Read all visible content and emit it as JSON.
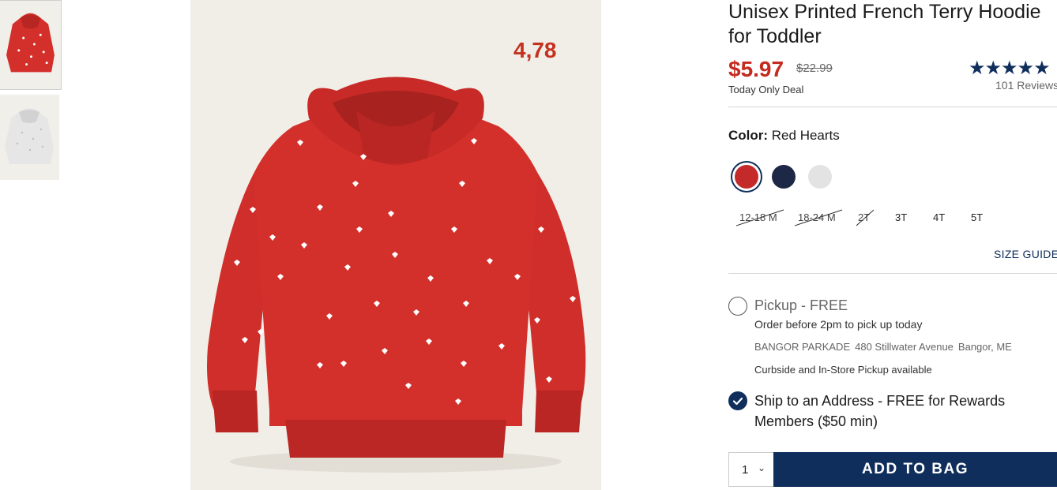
{
  "product": {
    "title": "Unisex Printed French Terry Hoodie for Toddler",
    "sale_price": "$5.97",
    "original_price": "$22.99",
    "deal_label": "Today Only Deal",
    "image_overlay_price": "4,78",
    "rating_stars": "★★★★★",
    "reviews": "101 Reviews"
  },
  "color": {
    "label": "Color:",
    "selected": "Red Hearts",
    "swatches": [
      {
        "name": "Red Hearts",
        "hex": "#c42a2a",
        "selected": true
      },
      {
        "name": "Navy",
        "hex": "#1d2846",
        "selected": false
      },
      {
        "name": "Light Gray",
        "hex": "#e3e3e3",
        "selected": false
      }
    ]
  },
  "sizes": [
    {
      "label": "12-18 M",
      "available": false
    },
    {
      "label": "18-24 M",
      "available": false
    },
    {
      "label": "2T",
      "available": false
    },
    {
      "label": "3T",
      "available": true
    },
    {
      "label": "4T",
      "available": true
    },
    {
      "label": "5T",
      "available": true
    }
  ],
  "size_guide": "SIZE GUIDE",
  "fulfillment": {
    "pickup_title": "Pickup - FREE",
    "pickup_sub": "Order before 2pm to pick up today",
    "store_name": "BANGOR PARKADE",
    "store_address": "480 Stillwater Avenue",
    "store_city": "Bangor, ME",
    "curbside": "Curbside and In-Store Pickup available",
    "ship": "Ship to an Address - FREE for Rewards Members ($50 min)"
  },
  "cart": {
    "quantity": "1",
    "add_label": "ADD TO BAG"
  },
  "colors": {
    "brand_navy": "#0f2e5c",
    "sale_red": "#c42a1f",
    "hoodie_red": "#d3302c"
  }
}
